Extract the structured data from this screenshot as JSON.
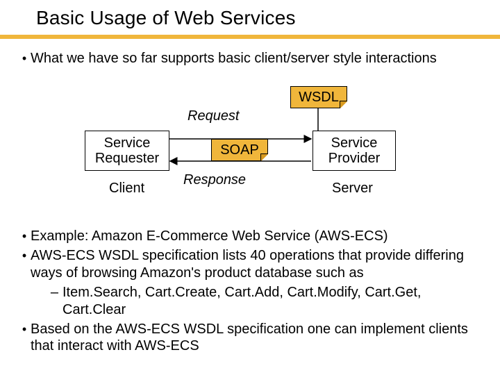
{
  "title": "Basic Usage of Web Services",
  "intro_bullet": "What we have so far supports basic client/server style interactions",
  "diagram": {
    "wsdl": "WSDL",
    "soap": "SOAP",
    "request": "Request",
    "response": "Response",
    "requester_line1": "Service",
    "requester_line2": "Requester",
    "provider_line1": "Service",
    "provider_line2": "Provider",
    "client": "Client",
    "server": "Server"
  },
  "lower": {
    "b1": "Example: Amazon E-Commerce Web Service (AWS-ECS)",
    "b2": "AWS-ECS WSDL specification lists 40 operations that provide differing ways of browsing Amazon's product database such as",
    "b2a": "Item.Search, Cart.Create, Cart.Add, Cart.Modify, Cart.Get, Cart.Clear",
    "b3": "Based on the AWS-ECS WSDL specification one can implement clients that interact with AWS-ECS"
  }
}
